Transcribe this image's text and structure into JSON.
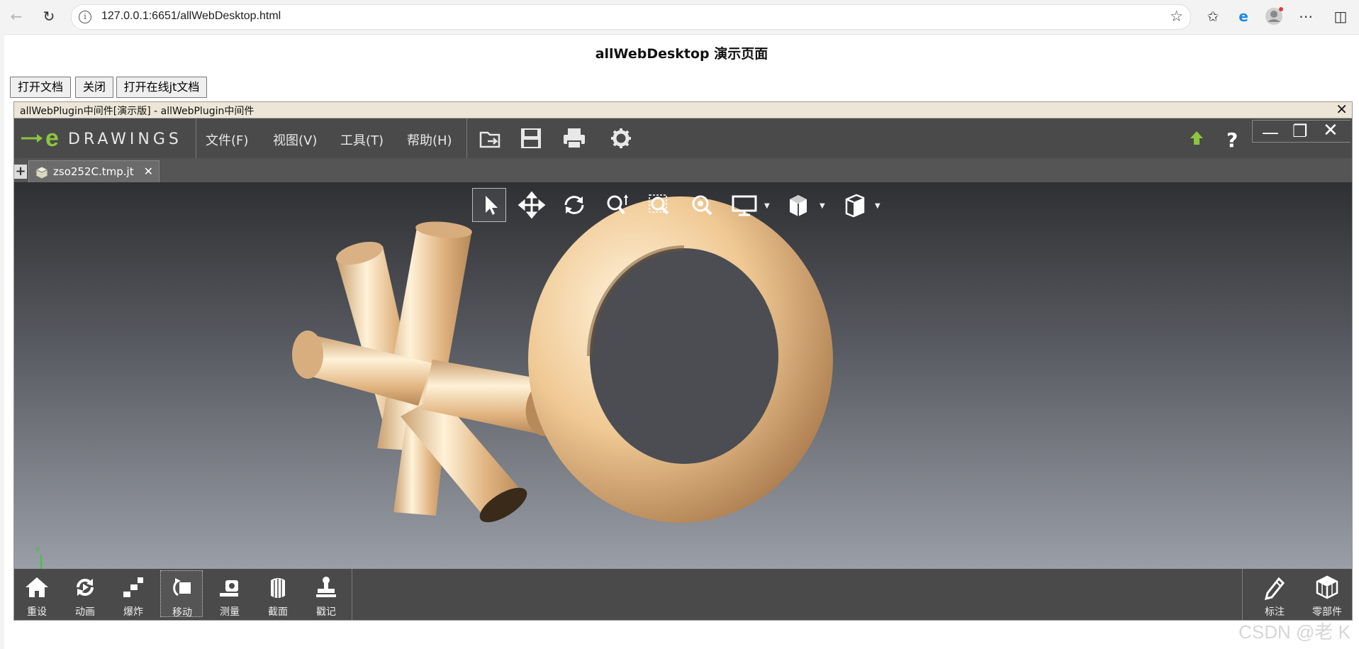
{
  "browser": {
    "url": "127.0.0.1:6651/allWebDesktop.html"
  },
  "page": {
    "title": "allWebDesktop 演示页面",
    "buttons": {
      "open_doc": "打开文档",
      "close": "关闭",
      "open_online": "打开在线jt文档"
    }
  },
  "plugin": {
    "window_title": "allWebPlugin中间件[演示版] - allWebPlugin中间件",
    "logo_text": "DRAWINGS",
    "menu": {
      "file": "文件(F)",
      "view": "视图(V)",
      "tools": "工具(T)",
      "help": "帮助(H)"
    },
    "tab": {
      "label": "zso252C.tmp.jt"
    },
    "axis_label": "Y",
    "bottom_tools": {
      "reset": "重设",
      "animate": "动画",
      "explode": "爆炸",
      "move": "移动",
      "measure": "测量",
      "section": "截面",
      "stamp": "戳记",
      "markup": "标注",
      "components": "零部件"
    }
  },
  "watermark": "CSDN @老 K",
  "colors": {
    "toolbar_bg": "#4a4a4a",
    "logo_green": "#8cc63f",
    "part_color": "#e2b889"
  }
}
